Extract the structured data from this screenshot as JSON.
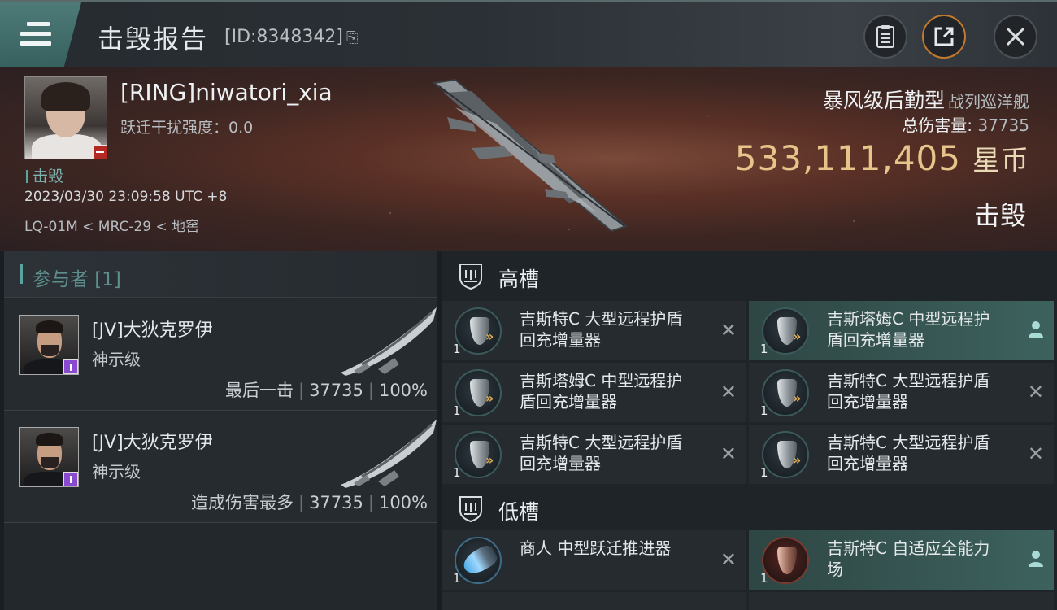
{
  "window": {
    "title": "击毁报告",
    "report_id": "[ID:8348342]",
    "copy_glyph": "⎘"
  },
  "victim": {
    "name": "[RING]niwatori_xia",
    "warp_jam": "跃迁干扰强度：0.0",
    "status": "击毁",
    "datetime": "2023/03/30 23:09:58 UTC +8",
    "location": "LQ-01M < MRC-29 < 地窖"
  },
  "ship": {
    "name": "暴风级后勤型",
    "class": "战列巡洋舰",
    "total_damage_label": "总伤害量:",
    "total_damage_value": "37735",
    "isk_value": "533,111,405",
    "isk_unit": "星币",
    "result": "击毁"
  },
  "participants": {
    "header": "参与者 [1]",
    "items": [
      {
        "name": "[JV]大狄克罗伊",
        "ship": "神示级",
        "tag": "最后一击",
        "damage": "37735",
        "percent": "100%"
      },
      {
        "name": "[JV]大狄克罗伊",
        "ship": "神示级",
        "tag": "造成伤害最多",
        "damage": "37735",
        "percent": "100%"
      }
    ]
  },
  "fittings": {
    "high_label": "高槽",
    "low_label": "低槽",
    "high": [
      {
        "name": "吉斯特C 大型远程护盾回充增量器",
        "qty": "1",
        "status": "✕",
        "highlight": false
      },
      {
        "name": "吉斯塔姆C 中型远程护盾回充增量器",
        "qty": "1",
        "status": "person",
        "highlight": true
      },
      {
        "name": "吉斯塔姆C 中型远程护盾回充增量器",
        "qty": "1",
        "status": "✕",
        "highlight": false
      },
      {
        "name": "吉斯特C 大型远程护盾回充增量器",
        "qty": "1",
        "status": "✕",
        "highlight": false
      },
      {
        "name": "吉斯特C 大型远程护盾回充增量器",
        "qty": "1",
        "status": "✕",
        "highlight": false
      },
      {
        "name": "吉斯特C 大型远程护盾回充增量器",
        "qty": "1",
        "status": "✕",
        "highlight": false
      }
    ],
    "low": [
      {
        "name": "商人 中型跃迁推进器",
        "qty": "1",
        "status": "✕",
        "highlight": false,
        "icon": "propulsion-icon"
      },
      {
        "name": "吉斯特C 自适应全能力场",
        "qty": "1",
        "status": "person",
        "highlight": true,
        "icon": "hardener-icon"
      }
    ]
  },
  "icons": {
    "menu": "menu-icon",
    "clipboard": "clipboard-icon",
    "share": "share-icon",
    "close": "close-icon",
    "person": "person-icon"
  },
  "colors": {
    "accent_teal": "#5aa39e",
    "isk_gold": "#e6c48a",
    "share_orange": "#c27a2c",
    "ship_class_highlight": "#8a4ad0"
  }
}
